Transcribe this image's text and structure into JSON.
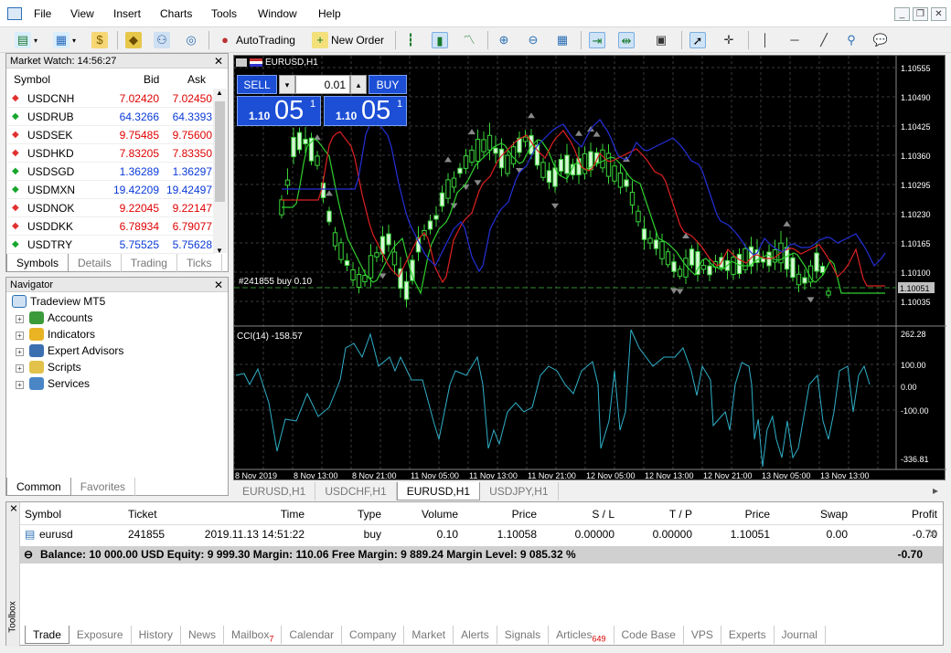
{
  "menu": {
    "items": [
      "File",
      "View",
      "Insert",
      "Charts",
      "Tools",
      "Window",
      "Help"
    ]
  },
  "toolbar": {
    "autotrading": "AutoTrading",
    "new_order": "New Order"
  },
  "market_watch": {
    "title": "Market Watch: 14:56:27",
    "col_symbol": "Symbol",
    "col_bid": "Bid",
    "col_ask": "Ask",
    "rows": [
      {
        "symbol": "USDCNH",
        "bid": "7.02420",
        "ask": "7.02450",
        "dir": "dn"
      },
      {
        "symbol": "USDRUB",
        "bid": "64.3266",
        "ask": "64.3393",
        "dir": "up"
      },
      {
        "symbol": "USDSEK",
        "bid": "9.75485",
        "ask": "9.75600",
        "dir": "dn"
      },
      {
        "symbol": "USDHKD",
        "bid": "7.83205",
        "ask": "7.83350",
        "dir": "dn"
      },
      {
        "symbol": "USDSGD",
        "bid": "1.36289",
        "ask": "1.36297",
        "dir": "up"
      },
      {
        "symbol": "USDMXN",
        "bid": "19.42209",
        "ask": "19.42497",
        "dir": "up"
      },
      {
        "symbol": "USDNOK",
        "bid": "9.22045",
        "ask": "9.22147",
        "dir": "dn"
      },
      {
        "symbol": "USDDKK",
        "bid": "6.78934",
        "ask": "6.79077",
        "dir": "dn"
      },
      {
        "symbol": "USDTRY",
        "bid": "5.75525",
        "ask": "5.75628",
        "dir": "up"
      }
    ],
    "tabs": [
      "Symbols",
      "Details",
      "Trading",
      "Ticks"
    ]
  },
  "navigator": {
    "title": "Navigator",
    "root": "Tradeview MT5",
    "items": [
      "Accounts",
      "Indicators",
      "Expert Advisors",
      "Scripts",
      "Services"
    ],
    "tabs": [
      "Common",
      "Favorites"
    ]
  },
  "chart": {
    "title": "EURUSD,H1",
    "sell": "SELL",
    "buy": "BUY",
    "volume": "0.01",
    "sell_price_small": "1.10",
    "sell_price_big": "05",
    "sell_price_sup": "1",
    "buy_price_small": "1.10",
    "buy_price_big": "05",
    "buy_price_sup": "1",
    "order_label": "#241855 buy 0.10",
    "current_price": "1.10051",
    "price_ticks": [
      "1.10555",
      "1.10490",
      "1.10425",
      "1.10360",
      "1.10295",
      "1.10230",
      "1.10165",
      "1.10100",
      "1.10035"
    ],
    "cci_label": "CCI(14) -158.57",
    "cci_ticks": [
      "262.28",
      "100.00",
      "0.00",
      "-100.00",
      "-336.81"
    ],
    "time_ticks": [
      "8 Nov 2019",
      "8 Nov 13:00",
      "8 Nov 21:00",
      "11 Nov 05:00",
      "11 Nov 13:00",
      "11 Nov 21:00",
      "12 Nov 05:00",
      "12 Nov 13:00",
      "12 Nov 21:00",
      "13 Nov 05:00",
      "13 Nov 13:00"
    ]
  },
  "chart_tabs": [
    "EURUSD,H1",
    "USDCHF,H1",
    "EURUSD,H1",
    "USDJPY,H1"
  ],
  "toolbox": {
    "headers": [
      "Symbol",
      "Ticket",
      "Time",
      "Type",
      "Volume",
      "Price",
      "S / L",
      "T / P",
      "Price",
      "Swap",
      "Profit"
    ],
    "row": [
      "eurusd",
      "241855",
      "2019.11.13 14:51:22",
      "buy",
      "0.10",
      "1.10058",
      "0.00000",
      "0.00000",
      "1.10051",
      "0.00",
      "-0.70"
    ],
    "balance": "Balance: 10 000.00 USD  Equity: 9 999.30  Margin: 110.06  Free Margin: 9 889.24  Margin Level: 9 085.32 %",
    "balance_profit": "-0.70",
    "side_label": "Toolbox",
    "tabs": [
      "Trade",
      "Exposure",
      "History",
      "News",
      "Mailbox",
      "Calendar",
      "Company",
      "Market",
      "Alerts",
      "Signals",
      "Articles",
      "Code Base",
      "VPS",
      "Experts",
      "Journal"
    ],
    "mailbox_badge": "7",
    "articles_badge": "649"
  }
}
